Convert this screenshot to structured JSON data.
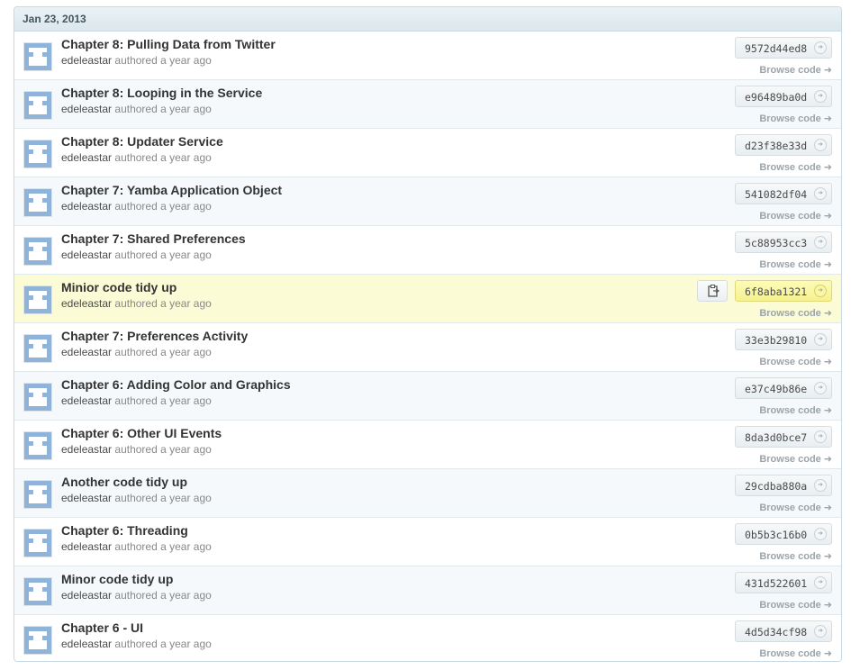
{
  "date_header": "Jan 23, 2013",
  "colors": {
    "avatar_blue": "#8fb3d9",
    "highlight_bg": "#fbfcd6",
    "sha_highlight": "#f5f190"
  },
  "commits": [
    {
      "title": "Chapter 8: Pulling Data from Twitter",
      "author": "edeleastar",
      "authored": "authored",
      "time": "a year ago",
      "sha": "9572d44ed8",
      "browse": "Browse code"
    },
    {
      "title": "Chapter 8: Looping in the Service",
      "author": "edeleastar",
      "authored": "authored",
      "time": "a year ago",
      "sha": "e96489ba0d",
      "browse": "Browse code"
    },
    {
      "title": "Chapter 8: Updater Service",
      "author": "edeleastar",
      "authored": "authored",
      "time": "a year ago",
      "sha": "d23f38e33d",
      "browse": "Browse code"
    },
    {
      "title": "Chapter 7: Yamba Application Object",
      "author": "edeleastar",
      "authored": "authored",
      "time": "a year ago",
      "sha": "541082df04",
      "browse": "Browse code"
    },
    {
      "title": "Chapter 7: Shared Preferences",
      "author": "edeleastar",
      "authored": "authored",
      "time": "a year ago",
      "sha": "5c88953cc3",
      "browse": "Browse code"
    },
    {
      "title": "Minior code tidy up",
      "author": "edeleastar",
      "authored": "authored",
      "time": "a year ago",
      "sha": "6f8aba1321",
      "browse": "Browse code"
    },
    {
      "title": "Chapter 7: Preferences Activity",
      "author": "edeleastar",
      "authored": "authored",
      "time": "a year ago",
      "sha": "33e3b29810",
      "browse": "Browse code"
    },
    {
      "title": "Chapter 6: Adding Color and Graphics",
      "author": "edeleastar",
      "authored": "authored",
      "time": "a year ago",
      "sha": "e37c49b86e",
      "browse": "Browse code"
    },
    {
      "title": "Chapter 6: Other UI Events",
      "author": "edeleastar",
      "authored": "authored",
      "time": "a year ago",
      "sha": "8da3d0bce7",
      "browse": "Browse code"
    },
    {
      "title": "Another code tidy up",
      "author": "edeleastar",
      "authored": "authored",
      "time": "a year ago",
      "sha": "29cdba880a",
      "browse": "Browse code"
    },
    {
      "title": "Chapter 6: Threading",
      "author": "edeleastar",
      "authored": "authored",
      "time": "a year ago",
      "sha": "0b5b3c16b0",
      "browse": "Browse code"
    },
    {
      "title": "Minor code tidy up",
      "author": "edeleastar",
      "authored": "authored",
      "time": "a year ago",
      "sha": "431d522601",
      "browse": "Browse code"
    },
    {
      "title": "Chapter 6 - UI",
      "author": "edeleastar",
      "authored": "authored",
      "time": "a year ago",
      "sha": "4d5d34cf98",
      "browse": "Browse code"
    }
  ]
}
